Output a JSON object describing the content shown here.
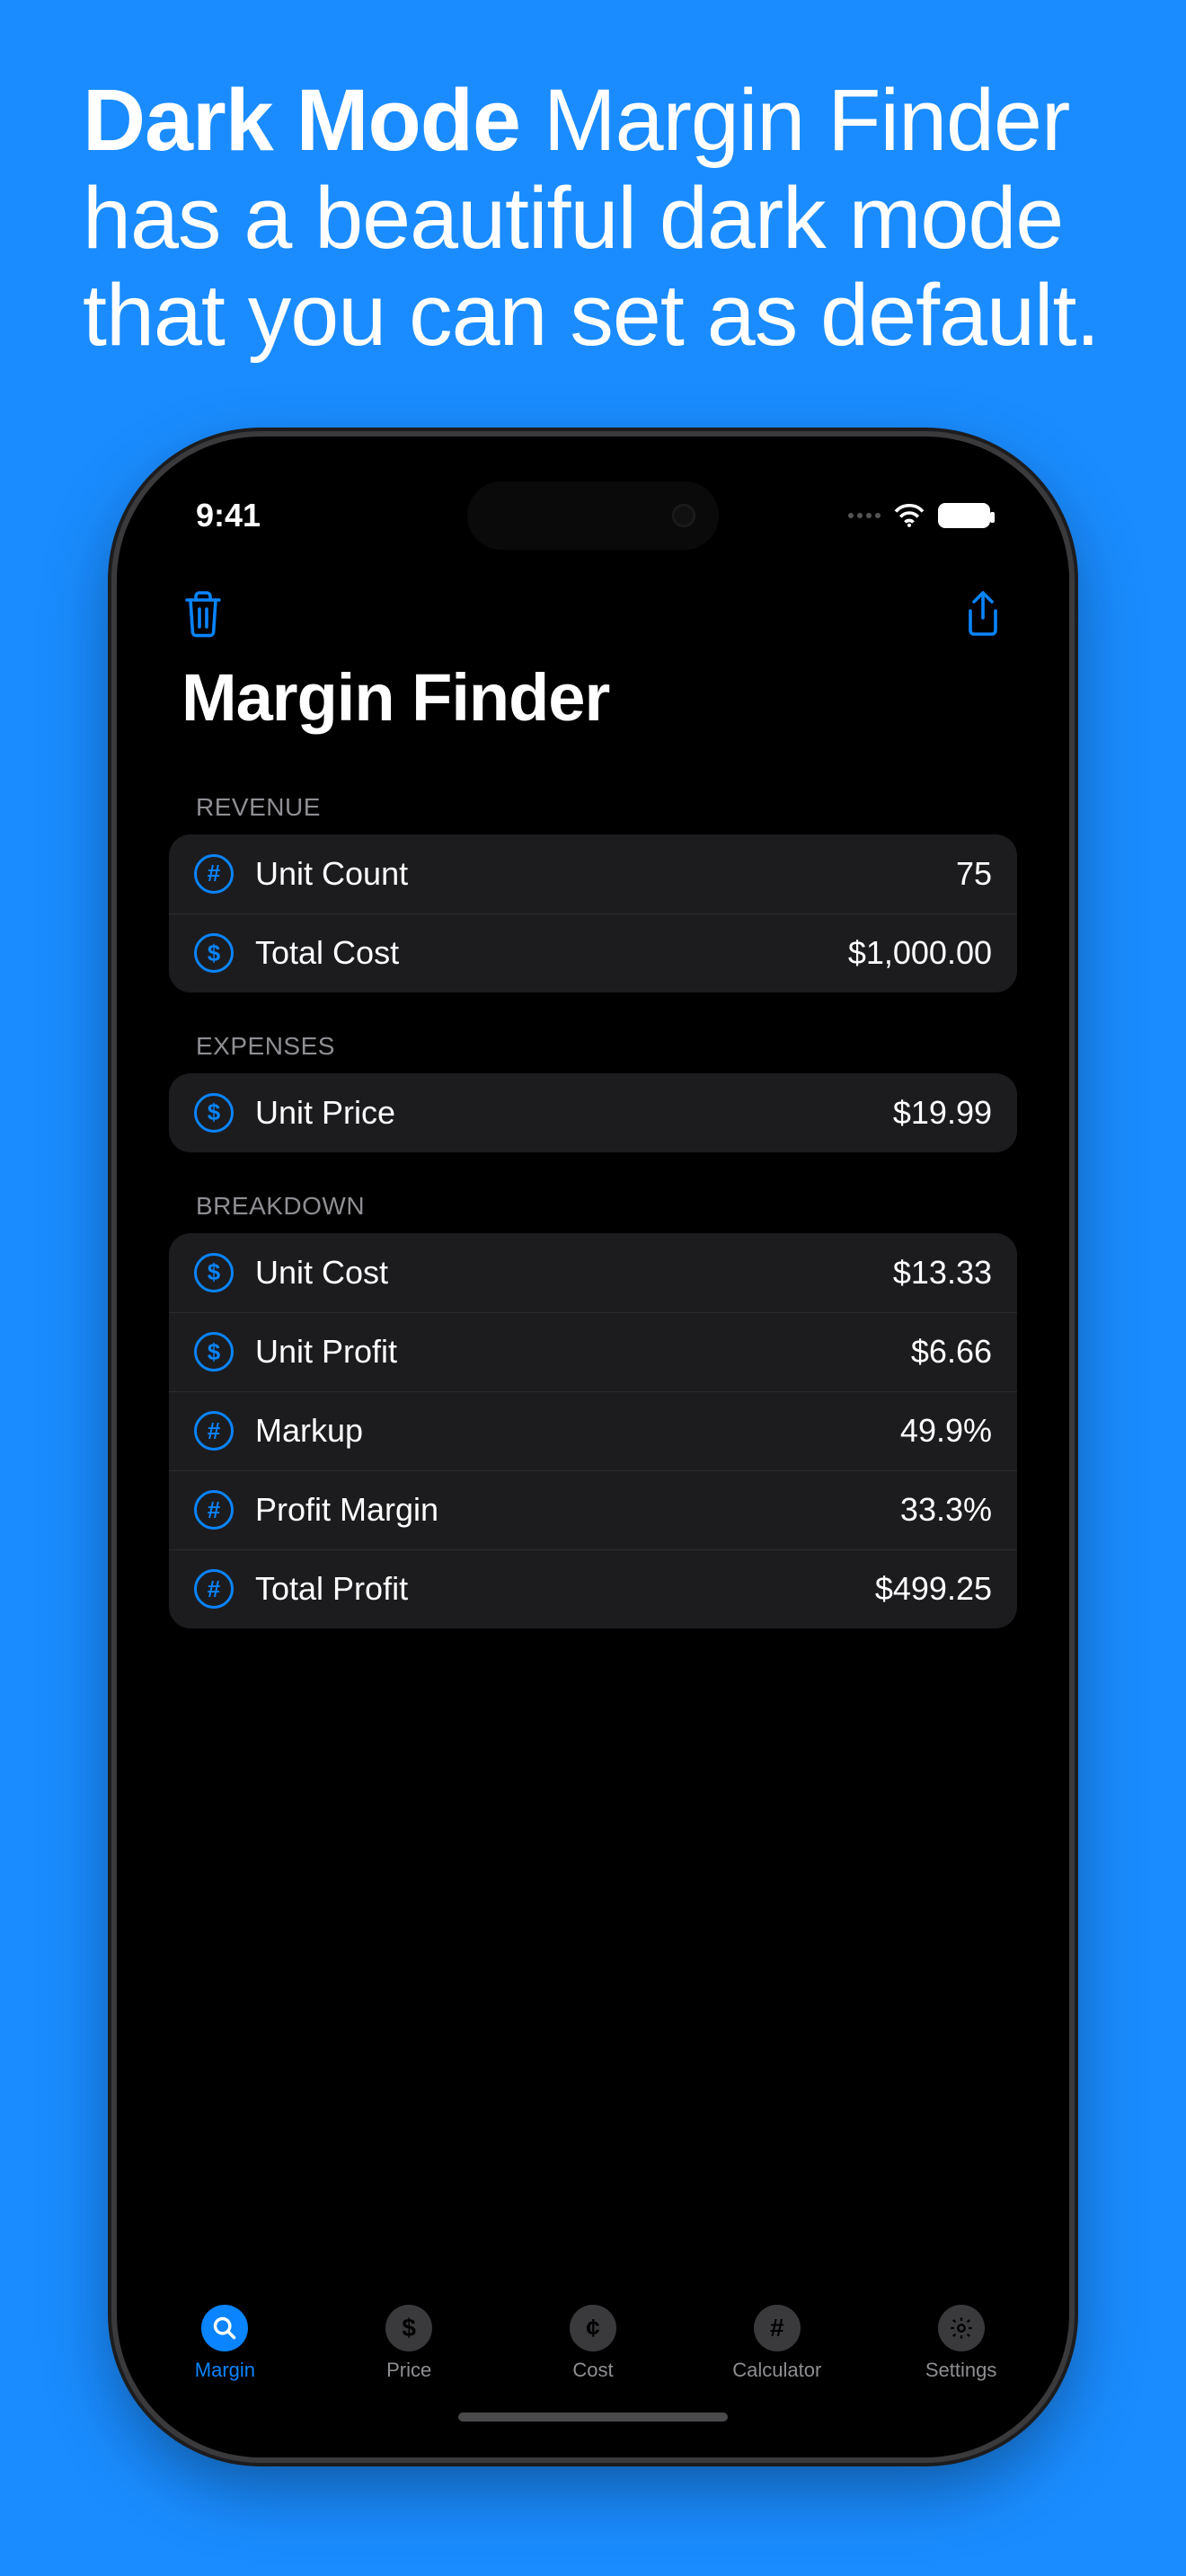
{
  "promo": {
    "bold": "Dark Mode",
    "rest": " Margin Finder has a beautiful dark mode that you can set as default."
  },
  "statusbar": {
    "time": "9:41"
  },
  "page_title": "Margin Finder",
  "colors": {
    "accent": "#0a84ff",
    "background": "#000000",
    "card": "#1c1c1e"
  },
  "sections": {
    "revenue": {
      "header": "REVENUE",
      "rows": [
        {
          "icon": "hash",
          "label": "Unit Count",
          "value": "75"
        },
        {
          "icon": "dollar",
          "label": "Total Cost",
          "value": "$1,000.00"
        }
      ]
    },
    "expenses": {
      "header": "EXPENSES",
      "rows": [
        {
          "icon": "dollar",
          "label": "Unit Price",
          "value": "$19.99"
        }
      ]
    },
    "breakdown": {
      "header": "BREAKDOWN",
      "rows": [
        {
          "icon": "dollar",
          "label": "Unit Cost",
          "value": "$13.33"
        },
        {
          "icon": "dollar",
          "label": "Unit Profit",
          "value": "$6.66"
        },
        {
          "icon": "hash",
          "label": "Markup",
          "value": "49.9%"
        },
        {
          "icon": "hash",
          "label": "Profit Margin",
          "value": "33.3%"
        },
        {
          "icon": "hash",
          "label": "Total Profit",
          "value": "$499.25"
        }
      ]
    }
  },
  "tabs": [
    {
      "label": "Margin",
      "icon": "search",
      "active": true
    },
    {
      "label": "Price",
      "icon": "dollar",
      "active": false
    },
    {
      "label": "Cost",
      "icon": "cent",
      "active": false
    },
    {
      "label": "Calculator",
      "icon": "hash",
      "active": false
    },
    {
      "label": "Settings",
      "icon": "gear",
      "active": false
    }
  ],
  "icon_glyphs": {
    "hash": "#",
    "dollar": "$",
    "cent": "¢"
  }
}
